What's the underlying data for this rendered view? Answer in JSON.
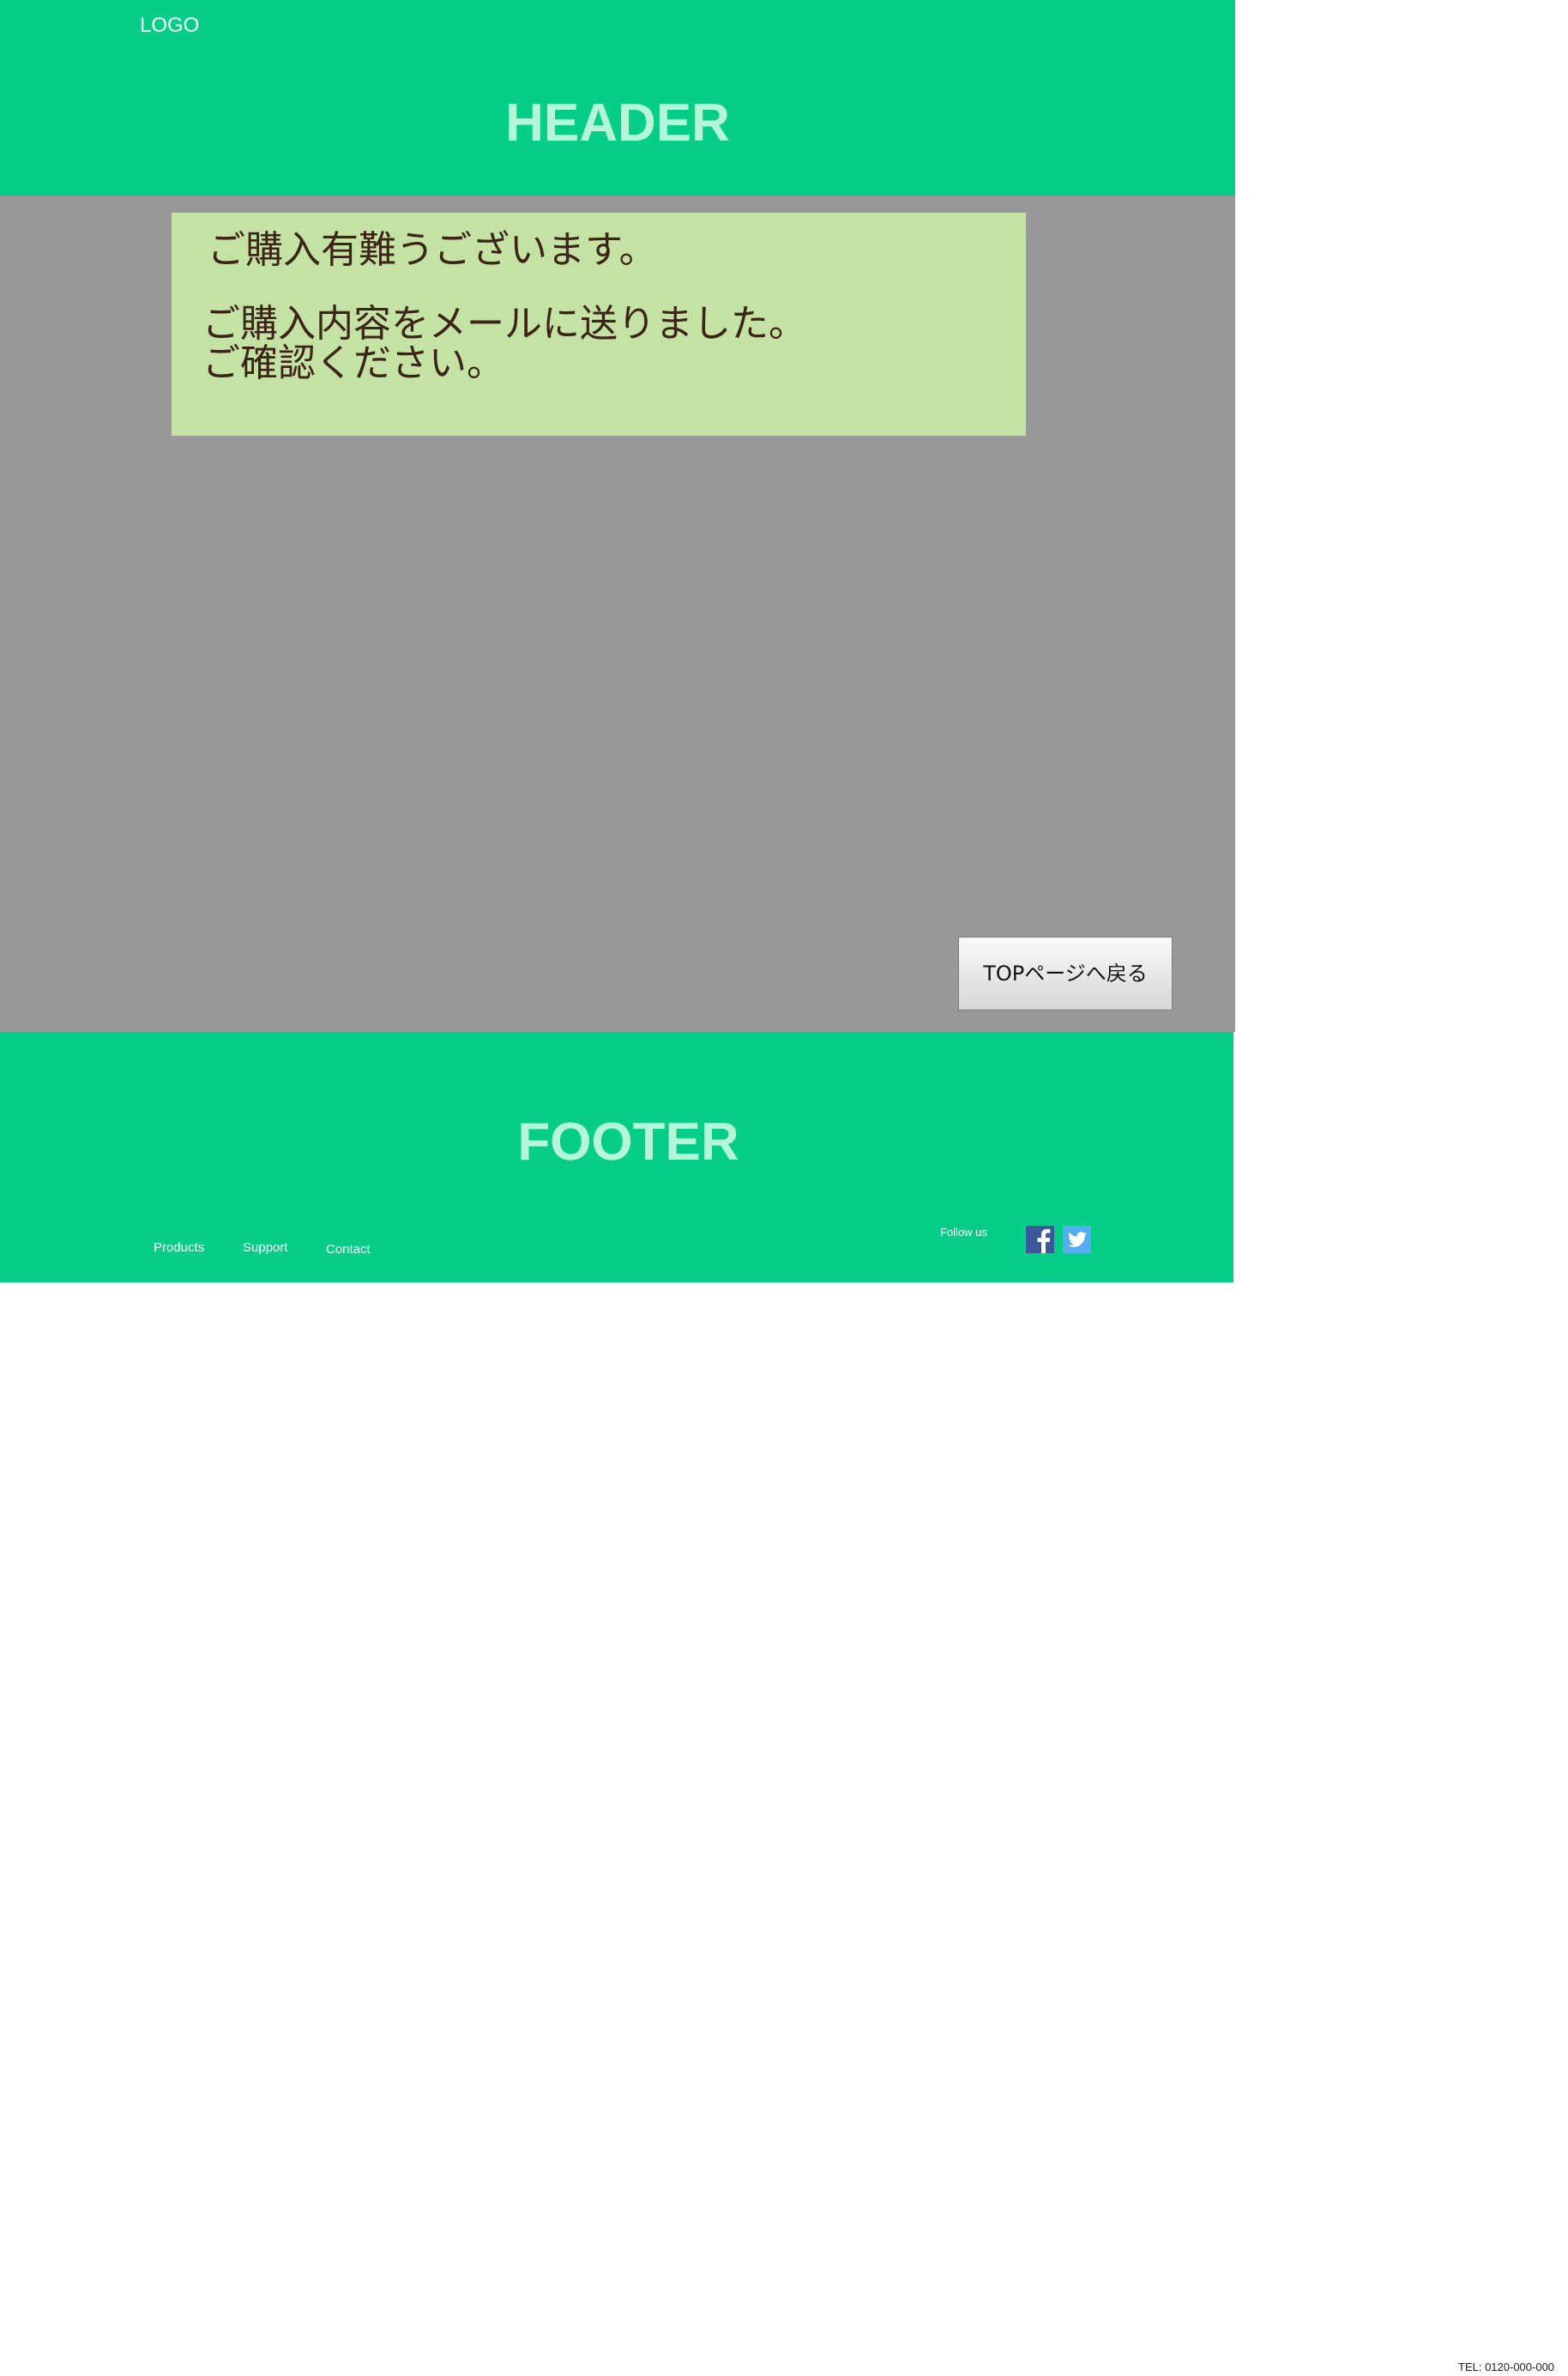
{
  "header": {
    "logo": "LOGO",
    "title": "HEADER"
  },
  "main": {
    "message": {
      "thanks": "ご購入有難うございます。",
      "sent": "ご購入内容をメールに送りました。",
      "confirm": "ご確認ください。"
    },
    "top_button_label": "TOPページへ戻る"
  },
  "footer": {
    "title": "FOOTER",
    "links": [
      "Products",
      "Support",
      "Contact"
    ],
    "follow_label": "Follow us",
    "social_icons": [
      "facebook-icon",
      "twitter-icon"
    ],
    "tel": "TEL: 0120-000-000"
  },
  "colors": {
    "accent_green": "#06cd88",
    "header_text": "#b4f6d6",
    "main_background": "#999999",
    "message_background": "#c4e2a3",
    "message_text": "#3c2418",
    "facebook": "#3b5998",
    "twitter": "#55acee"
  }
}
